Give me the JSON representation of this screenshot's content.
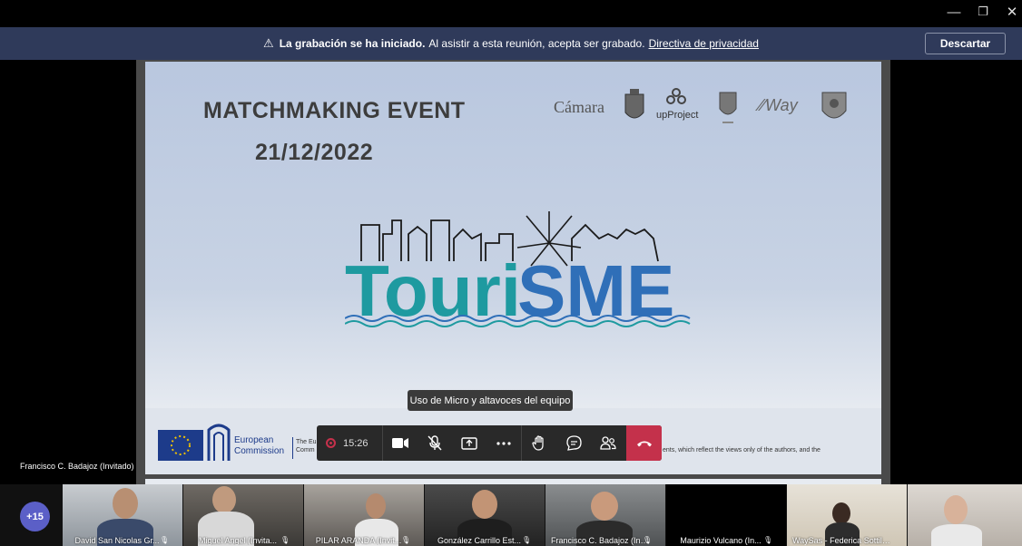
{
  "window": {
    "minimize": "—",
    "restore": "❐",
    "close": "✕"
  },
  "banner": {
    "bold_text": "La grabación se ha iniciado.",
    "text": "Al asistir a esta reunión, acepta ser grabado.",
    "link": "Directiva de privacidad",
    "discard_label": "Descartar"
  },
  "slide": {
    "title": "MATCHMAKING EVENT",
    "date": "21/12/2022",
    "logo_camara": "Cámara",
    "logo_upproject": "upProject",
    "logo_way": "Way",
    "brand": "TouriSME",
    "eu_name_1": "European",
    "eu_name_2": "Commission",
    "eu_side_1": "The Eu",
    "eu_side_2": "Comm",
    "footer_note": "ents, which reflect the views only of the authors, and the"
  },
  "tooltip": "Uso de Micro y altavoces del equipo",
  "controls": {
    "timer": "15:26"
  },
  "presenter_name": "Francisco C. Badajoz (Invitado)",
  "gallery": {
    "overflow_count": "+15",
    "participants": [
      {
        "name": "David San Nicolas Gr..."
      },
      {
        "name": "Miguel Angel (Invita..."
      },
      {
        "name": "PILAR ARANDA (Invit..."
      },
      {
        "name": "González Carrillo Est..."
      },
      {
        "name": "Francisco C. Badajoz (Invit..."
      },
      {
        "name": "Maurizio Vulcano (In..."
      },
      {
        "name": "WaySas - Federica Sottile ..."
      },
      {
        "name": ""
      }
    ]
  },
  "colors": {
    "banner_bg": "#2f3a5a",
    "hangup": "#c4314b",
    "brand_teal": "#1e9aa0",
    "brand_blue": "#2f6fb8",
    "avatar": "#5b5fc7"
  }
}
